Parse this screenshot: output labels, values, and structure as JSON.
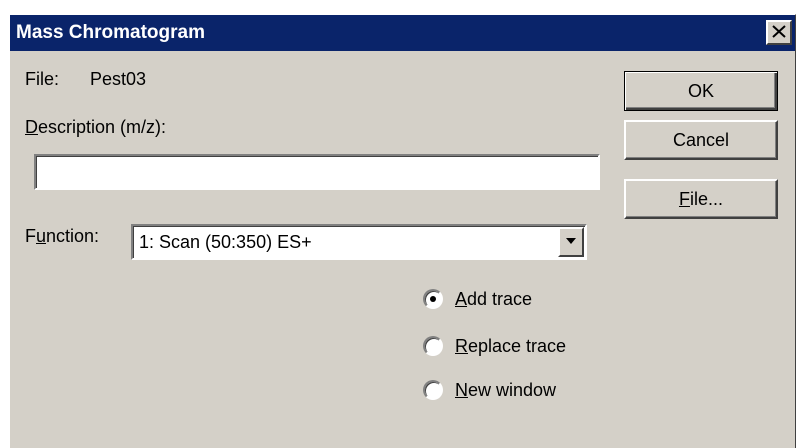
{
  "window": {
    "title": "Mass Chromatogram",
    "close_glyph": "✕",
    "background": "#d4d0c8",
    "titlebar_color": "#0a246a"
  },
  "file": {
    "label": "File:",
    "value": "Pest03"
  },
  "description": {
    "label_mnemonic": "D",
    "label_rest": "escription (m/z):",
    "value": ""
  },
  "function": {
    "label_pre": "F",
    "label_mnemonic": "u",
    "label_rest": "nction:",
    "selected": "1: Scan (50:350) ES+"
  },
  "buttons": {
    "ok": "OK",
    "cancel": "Cancel",
    "file_mnemonic": "F",
    "file_rest": "ile..."
  },
  "trace_options": [
    {
      "mnemonic": "A",
      "rest": "dd trace",
      "selected": true
    },
    {
      "mnemonic": "R",
      "rest": "eplace trace",
      "selected": false
    },
    {
      "mnemonic": "N",
      "rest": "ew window",
      "selected": false
    }
  ]
}
